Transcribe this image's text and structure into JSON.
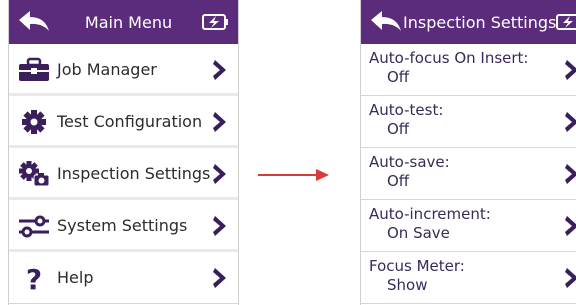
{
  "left_screen": {
    "title": "Main Menu",
    "items": [
      {
        "label": "Job Manager",
        "icon": "briefcase-icon"
      },
      {
        "label": "Test Configuration",
        "icon": "gear-icon"
      },
      {
        "label": "Inspection Settings",
        "icon": "gears-camera-icon"
      },
      {
        "label": "System Settings",
        "icon": "sliders-icon"
      },
      {
        "label": "Help",
        "icon": "question-icon"
      }
    ]
  },
  "right_screen": {
    "title": "Inspection Settings",
    "settings": [
      {
        "label": "Auto-focus On Insert:",
        "value": "Off"
      },
      {
        "label": "Auto-test:",
        "value": "Off"
      },
      {
        "label": "Auto-save:",
        "value": "Off"
      },
      {
        "label": "Auto-increment:",
        "value": "On Save"
      },
      {
        "label": "Focus Meter:",
        "value": "Show"
      }
    ]
  },
  "colors": {
    "header": "#5b2c7c",
    "accent": "#3a1f5c",
    "arrow": "#d93a3a"
  }
}
